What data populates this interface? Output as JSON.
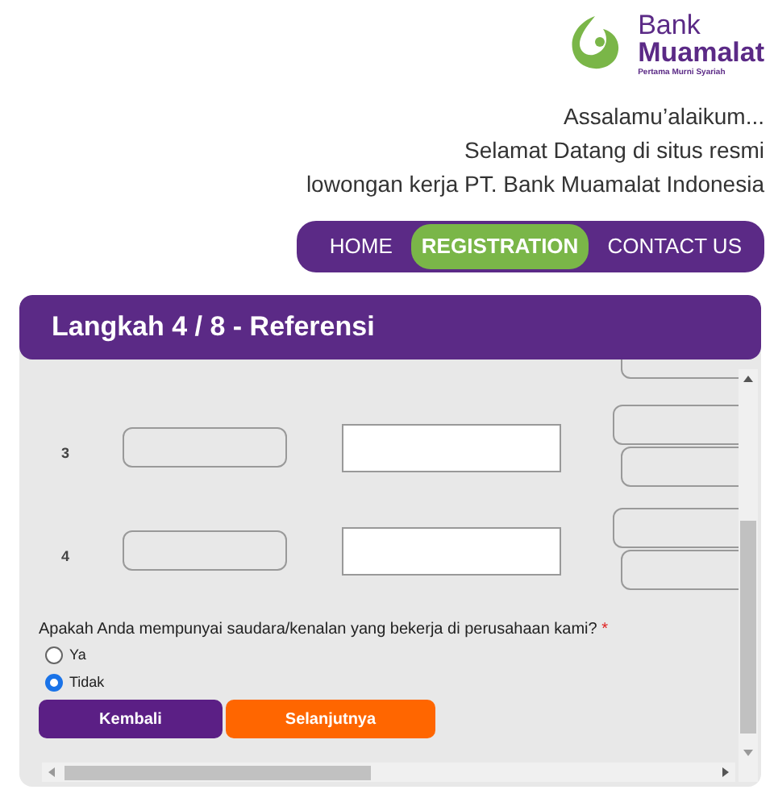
{
  "logo": {
    "line1": "Bank",
    "line2": "Muamalat",
    "tagline": "Pertama Murni Syariah"
  },
  "greeting": [
    "Assalamu’alaikum...",
    "Selamat Datang di situs resmi",
    "lowongan kerja PT. Bank Muamalat Indonesia"
  ],
  "nav": [
    {
      "label": "HOME",
      "selected": false
    },
    {
      "label": "REGISTRATION",
      "selected": true
    },
    {
      "label": "CONTACT US",
      "selected": false
    }
  ],
  "step_title": "Langkah 4 / 8 - Referensi",
  "rows": [
    {
      "number": "3"
    },
    {
      "number": "4"
    }
  ],
  "question": {
    "text": "Apakah Anda mempunyai saudara/kenalan yang bekerja di perusahaan kami?",
    "required_mark": "*",
    "options": [
      {
        "label": "Ya",
        "selected": false
      },
      {
        "label": "Tidak",
        "selected": true
      }
    ]
  },
  "buttons": [
    {
      "label": "Kembali",
      "kind": "back"
    },
    {
      "label": "Selanjutnya",
      "kind": "next"
    }
  ]
}
